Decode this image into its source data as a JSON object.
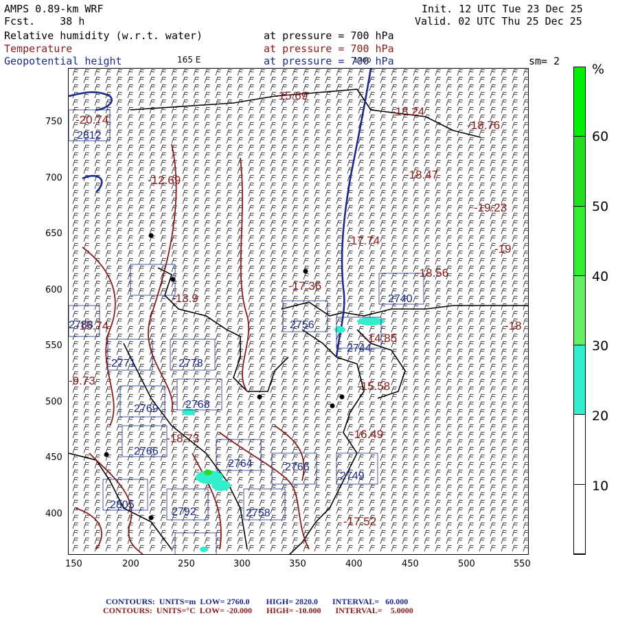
{
  "header": {
    "model": "AMPS 0.89-km WRF",
    "fcst_label": "Fcst.",
    "fcst_value": "38 h",
    "init": "Init. 12 UTC Tue 23 Dec 25",
    "valid": "Valid. 02 UTC Thu 25 Dec 25",
    "field1": "Relative humidity (w.r.t. water)",
    "field2": "Temperature",
    "field3": "Geopotential height",
    "pressure_text": "at pressure =",
    "pressure_value": "700 hPa",
    "longitude_label": "165 E",
    "smoothing": "sm= 2",
    "inset_number": "1700"
  },
  "axes": {
    "x_ticks": [
      "150",
      "200",
      "250",
      "300",
      "350",
      "400",
      "450",
      "500",
      "550"
    ],
    "y_ticks": [
      "750",
      "700",
      "650",
      "600",
      "550",
      "500",
      "450",
      "400"
    ]
  },
  "colorbar": {
    "unit": "%",
    "labels": [
      "60",
      "50",
      "40",
      "30",
      "20",
      "10"
    ],
    "colors": [
      "#00ee00",
      "#22dd22",
      "#33ee33",
      "#66ee66",
      "#33eecc",
      "#ffffff",
      "#ffffff",
      "#ffffff"
    ]
  },
  "temperature_labels": [
    {
      "text": "-15.69"
    },
    {
      "text": "-18.24"
    },
    {
      "text": "-18.76"
    },
    {
      "text": "-18.47"
    },
    {
      "text": "-19.23"
    },
    {
      "text": "-17.74"
    },
    {
      "text": "-19"
    },
    {
      "text": "-18.56"
    },
    {
      "text": "-17.36"
    },
    {
      "text": "-18"
    },
    {
      "text": "-12.69"
    },
    {
      "text": "-13.9"
    },
    {
      "text": "-15.58"
    },
    {
      "text": "-16.49"
    },
    {
      "text": "-17.52"
    },
    {
      "text": "-18.73"
    },
    {
      "text": "-14.85"
    },
    {
      "text": "-9.73"
    },
    {
      "text": "-20.74"
    },
    {
      "text": "-15.74"
    }
  ],
  "height_labels": [
    {
      "text": "2812"
    },
    {
      "text": "2740"
    },
    {
      "text": "2756"
    },
    {
      "text": "2744"
    },
    {
      "text": "2771"
    },
    {
      "text": "2778"
    },
    {
      "text": "2769"
    },
    {
      "text": "2768"
    },
    {
      "text": "2766"
    },
    {
      "text": "2764"
    },
    {
      "text": "2766"
    },
    {
      "text": "2749"
    },
    {
      "text": "2805"
    },
    {
      "text": "2792"
    },
    {
      "text": "2758"
    },
    {
      "text": "2788"
    }
  ],
  "footer": {
    "line1_label": "CONTOURS:  UNITS=m  LOW=",
    "line1_low": "2760.0",
    "line1_high_label": "HIGH=",
    "line1_high": "2820.0",
    "line1_int_label": "INTERVAL=",
    "line1_int": "60.000",
    "line2_label": "CONTOURS:  UNITS=°C  LOW=",
    "line2_low": "-20.000",
    "line2_high_label": "HIGH=",
    "line2_high": "-10.000",
    "line2_int_label": "INTERVAL=",
    "line2_int": "5.0000"
  }
}
